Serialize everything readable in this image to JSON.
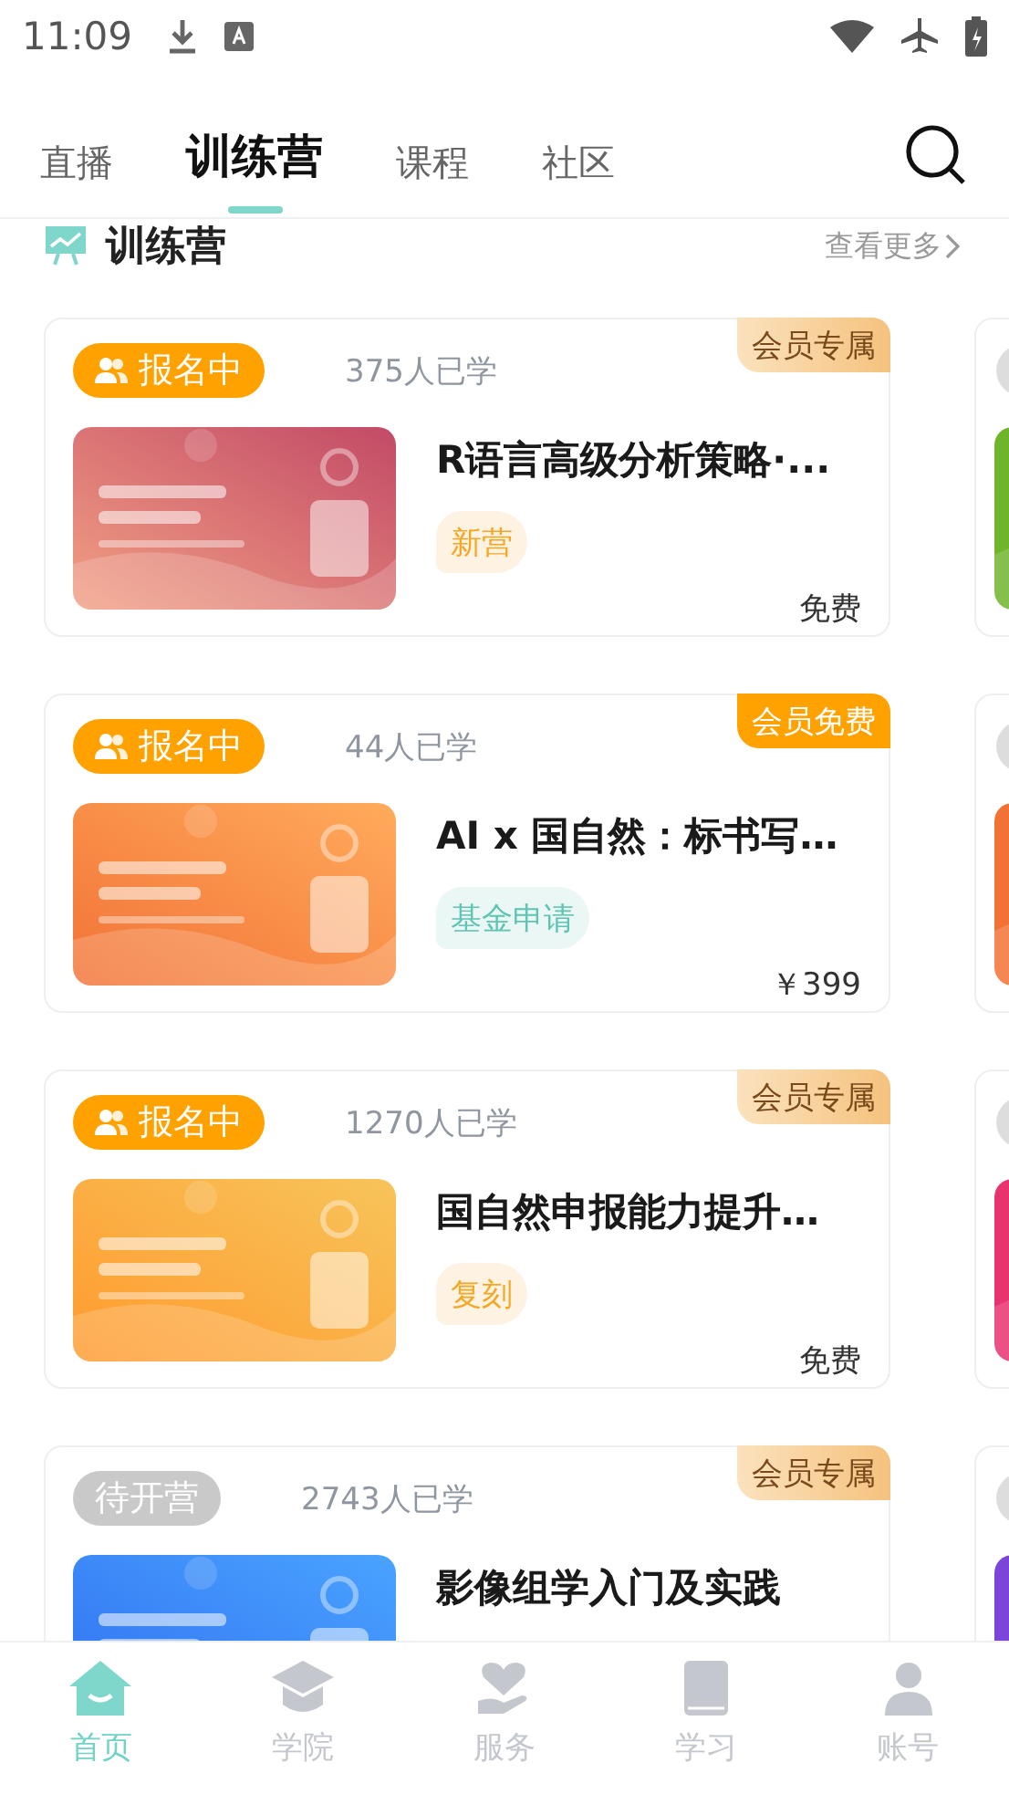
{
  "status_bar": {
    "time": "11:09"
  },
  "tabs": [
    {
      "label": "直播",
      "selected": false
    },
    {
      "label": "训练营",
      "selected": true
    },
    {
      "label": "课程",
      "selected": false
    },
    {
      "label": "社区",
      "selected": false
    }
  ],
  "section": {
    "title": "训练营",
    "more": "查看更多"
  },
  "cards": [
    {
      "status": {
        "kind": "enrolling",
        "label": "报名中"
      },
      "learners": "375人已学",
      "corner": {
        "kind": "member-only",
        "label": "会员专属"
      },
      "title": "R语言高级分析策略·...",
      "tag": {
        "label": "新营",
        "color": "#f5a623"
      },
      "price": "免费"
    },
    {
      "status": {
        "kind": "enrolling",
        "label": "报名中"
      },
      "learners": "44人已学",
      "corner": {
        "kind": "member-free",
        "label": "会员免费"
      },
      "title": "AI x 国自然：标书写…",
      "tag": {
        "label": "基金申请",
        "color": "#5fc4b4"
      },
      "price": "￥399"
    },
    {
      "status": {
        "kind": "enrolling",
        "label": "报名中"
      },
      "learners": "1270人已学",
      "corner": {
        "kind": "member-only",
        "label": "会员专属"
      },
      "title": "国自然申报能力提升…",
      "tag": {
        "label": "复刻",
        "color": "#f5a623"
      },
      "price": "免费"
    },
    {
      "status": {
        "kind": "pending",
        "label": "待开营"
      },
      "learners": "2743人已学",
      "corner": {
        "kind": "member-only",
        "label": "会员专属"
      },
      "title": "影像组学入门及实践"
    }
  ],
  "bottom_nav": [
    {
      "label": "首页",
      "selected": true
    },
    {
      "label": "学院",
      "selected": false
    },
    {
      "label": "服务",
      "selected": false
    },
    {
      "label": "学习",
      "selected": false
    },
    {
      "label": "账号",
      "selected": false
    }
  ]
}
